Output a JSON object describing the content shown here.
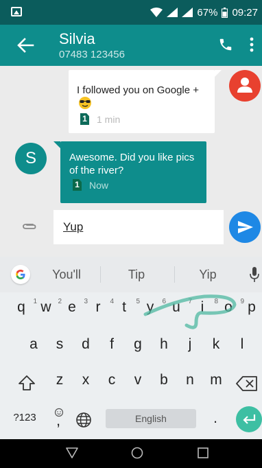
{
  "status_bar": {
    "battery": "67%",
    "time": "09:27"
  },
  "contact": {
    "name": "Silvia",
    "number": "07483 123456"
  },
  "messages": [
    {
      "text": "I followed you on Google +",
      "sim": "1",
      "time": "1 min"
    },
    {
      "avatar_letter": "S",
      "text": "Awesome. Did you like pics of the river?",
      "sim": "1",
      "time": "Now"
    }
  ],
  "compose": {
    "value": "Yup"
  },
  "keyboard": {
    "suggestions": [
      "You'll",
      "Tip",
      "Yip"
    ],
    "row1": [
      "q",
      "w",
      "e",
      "r",
      "t",
      "y",
      "u",
      "i",
      "o",
      "p"
    ],
    "row1_hints": [
      "1",
      "2",
      "3",
      "4",
      "5",
      "6",
      "7",
      "8",
      "9",
      "0"
    ],
    "row2": [
      "a",
      "s",
      "d",
      "f",
      "g",
      "h",
      "j",
      "k",
      "l"
    ],
    "row3": [
      "z",
      "x",
      "c",
      "v",
      "b",
      "n",
      "m"
    ],
    "symbols_key": "?123",
    "comma_key": ",",
    "space_label": "English",
    "period_key": "."
  },
  "colors": {
    "teal": "#0e8d8c",
    "status": "#0b5c5c",
    "send": "#1e88e5",
    "enter": "#3dbfa3",
    "avatar_me": "#e8412f"
  }
}
